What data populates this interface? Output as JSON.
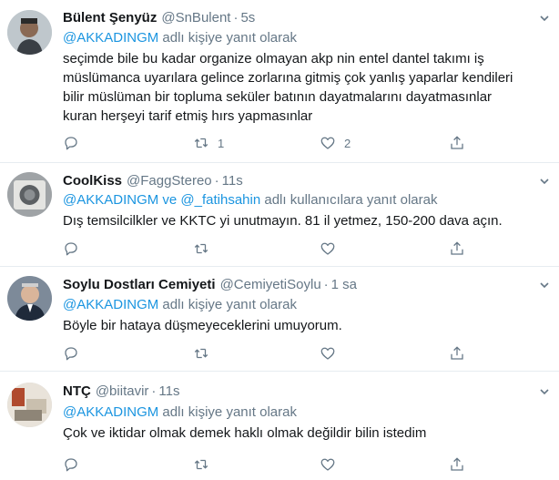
{
  "tweets": [
    {
      "name": "Bülent Şenyüz",
      "handle": "@SnBulent",
      "dot": "·",
      "time": "5s",
      "reply_prefix": "",
      "reply_mention": "@AKKADINGM",
      "reply_suffix": " adlı kişiye yanıt olarak",
      "text": "seçimde bile bu kadar organize olmayan akp nin entel dantel takımı iş müslümanca uyarılara gelince zorlarına gitmiş çok yanlış yaparlar kendileri bilir müslüman bir topluma seküler batının dayatmalarını dayatmasınlar kuran herşeyi tarif etmiş hırs yapmasınlar",
      "retweets": "1",
      "likes": "2"
    },
    {
      "name": "CoolKiss",
      "handle": "@FaggStereo",
      "dot": "·",
      "time": "11s",
      "reply_mention": "@AKKADINGM ve @_fatihsahin",
      "reply_suffix": " adlı kullanıcılara yanıt olarak",
      "text": "Dış temsilcilkler ve KKTC yi unutmayın. 81 il yetmez, 150-200 dava açın.",
      "retweets": "",
      "likes": ""
    },
    {
      "name": "Soylu Dostları Cemiyeti",
      "handle": "@CemiyetiSoylu",
      "dot": "·",
      "time": "1 sa",
      "reply_mention": "@AKKADINGM",
      "reply_suffix": " adlı kişiye yanıt olarak",
      "text": "Böyle bir hataya düşmeyeceklerini umuyorum.",
      "retweets": "",
      "likes": ""
    },
    {
      "name": "NTÇ",
      "handle": "@biitavir",
      "dot": "·",
      "time": "11s",
      "reply_mention": "@AKKADINGM",
      "reply_suffix": " adlı kişiye yanıt olarak",
      "text": "Çok ve iktidar olmak demek haklı olmak değildir bilin istedim",
      "retweets": "",
      "likes": ""
    }
  ],
  "icons": {
    "reply": "reply-icon",
    "retweet": "retweet-icon",
    "like": "heart-icon",
    "share": "share-icon",
    "menu": "chevron-down-icon"
  },
  "colors": {
    "link": "#1b95e0",
    "muted": "#657786",
    "text": "#14171a",
    "divider": "#e6ecf0"
  }
}
